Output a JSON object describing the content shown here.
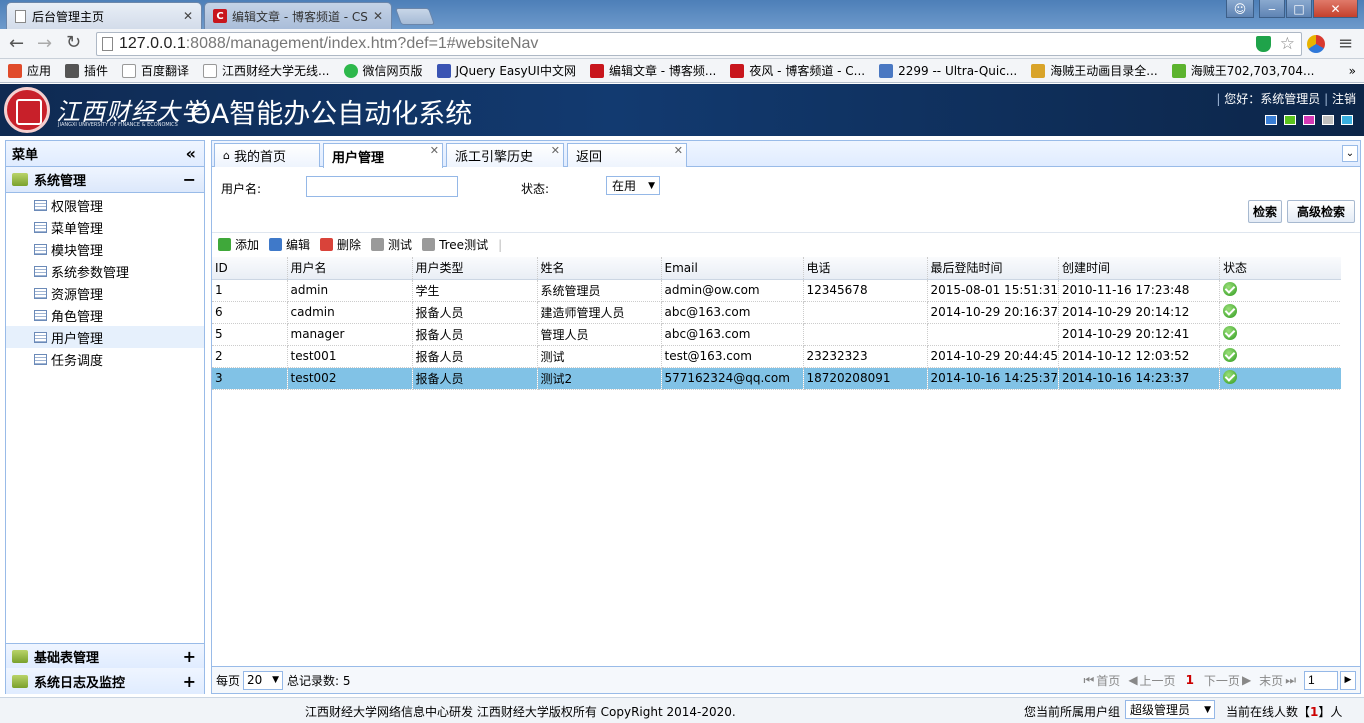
{
  "browser": {
    "tabs": [
      {
        "title": "后台管理主页",
        "active": true
      },
      {
        "title": "编辑文章 - 博客频道 - CS",
        "active": false
      }
    ],
    "url_host": "127.0.0.1",
    "url_rest": ":8088/management/index.htm?def=1#websiteNav",
    "bookmarks": [
      {
        "label": "应用",
        "color": "#e04b2b"
      },
      {
        "label": "插件",
        "color": "#555555"
      },
      {
        "label": "百度翻译",
        "color": "#cccccc"
      },
      {
        "label": "江西财经大学无线...",
        "color": "#cccccc"
      },
      {
        "label": "微信网页版",
        "color": "#2db84c"
      },
      {
        "label": "JQuery EasyUI中文网",
        "color": "#3a54b3"
      },
      {
        "label": "编辑文章 - 博客频...",
        "color": "#c8161d"
      },
      {
        "label": "夜风 - 博客频道 - C...",
        "color": "#c8161d"
      },
      {
        "label": "2299 -- Ultra-Quic...",
        "color": "#4a78c2"
      },
      {
        "label": "海贼王动画目录全...",
        "color": "#d9a42a"
      },
      {
        "label": "海贼王702,703,704...",
        "color": "#5cb32e"
      }
    ]
  },
  "header": {
    "university": "江西财经大学",
    "university_en": "JIANGXI UNIVERSITY OF FINANCE & ECONOMICS",
    "system_title": "OA智能办公自动化系统",
    "greeting": "您好：系统管理员",
    "logout": "注销",
    "theme_colors": [
      "#3a7fd5",
      "#5cc31e",
      "#d53ab5",
      "#c0c0c0",
      "#3ab0e0"
    ]
  },
  "sidebar": {
    "title": "菜单",
    "sections": [
      {
        "label": "系统管理",
        "toggle": "−"
      },
      {
        "label": "基础表管理",
        "toggle": "+"
      },
      {
        "label": "系统日志及监控",
        "toggle": "+"
      }
    ],
    "items": [
      {
        "label": "权限管理"
      },
      {
        "label": "菜单管理"
      },
      {
        "label": "模块管理"
      },
      {
        "label": "系统参数管理"
      },
      {
        "label": "资源管理"
      },
      {
        "label": "角色管理"
      },
      {
        "label": "用户管理",
        "selected": true
      },
      {
        "label": "任务调度"
      }
    ]
  },
  "tabs": [
    {
      "label": "我的首页",
      "closable": false
    },
    {
      "label": "用户管理",
      "closable": true,
      "active": true
    },
    {
      "label": "派工引擎历史",
      "closable": true
    },
    {
      "label": "返回",
      "closable": true
    }
  ],
  "search": {
    "username_label": "用户名:",
    "username_value": "",
    "status_label": "状态:",
    "status_value": "在用",
    "search_button": "检索",
    "advanced_button": "高级检索"
  },
  "grid_toolbar": [
    {
      "label": "添加",
      "color": "#3fa83a"
    },
    {
      "label": "编辑",
      "color": "#3f79c9"
    },
    {
      "label": "删除",
      "color": "#d9433a"
    },
    {
      "label": "测试",
      "color": "#9a9a9a"
    },
    {
      "label": "Tree测试",
      "color": "#9a9a9a"
    }
  ],
  "table": {
    "columns": [
      "ID",
      "用户名",
      "用户类型",
      "姓名",
      "Email",
      "电话",
      "最后登陆时间",
      "创建时间",
      "状态"
    ],
    "rows": [
      [
        "1",
        "admin",
        "学生",
        "系统管理员",
        "admin@ow.com",
        "12345678",
        "2015-08-01 15:51:31",
        "2010-11-16 17:23:48"
      ],
      [
        "6",
        "cadmin",
        "报备人员",
        "建造师管理人员",
        "abc@163.com",
        "",
        "2014-10-29 20:16:37",
        "2014-10-29 20:14:12"
      ],
      [
        "5",
        "manager",
        "报备人员",
        "管理人员",
        "abc@163.com",
        "",
        "",
        "2014-10-29 20:12:41"
      ],
      [
        "2",
        "test001",
        "报备人员",
        "测试",
        "test@163.com",
        "23232323",
        "2014-10-29 20:44:45",
        "2014-10-12 12:03:52"
      ],
      [
        "3",
        "test002",
        "报备人员",
        "测试2",
        "577162324@qq.com",
        "18720208091",
        "2014-10-16 14:25:37",
        "2014-10-16 14:23:37"
      ]
    ],
    "selected_row": 4
  },
  "pager": {
    "per_page_label": "每页",
    "page_size": "20",
    "total_label": "总记录数: 5",
    "first": "首页",
    "prev": "上一页",
    "current": "1",
    "next": "下一页",
    "last": "末页",
    "goto_value": "1"
  },
  "footer": {
    "copyright": "江西财经大学网络信息中心研发 江西财经大学版权所有 CopyRight 2014-2020.",
    "group_label": "您当前所属用户组",
    "group_value": "超级管理员",
    "online_prefix": "当前在线人数【",
    "online_count": "1",
    "online_suffix": "】人"
  }
}
